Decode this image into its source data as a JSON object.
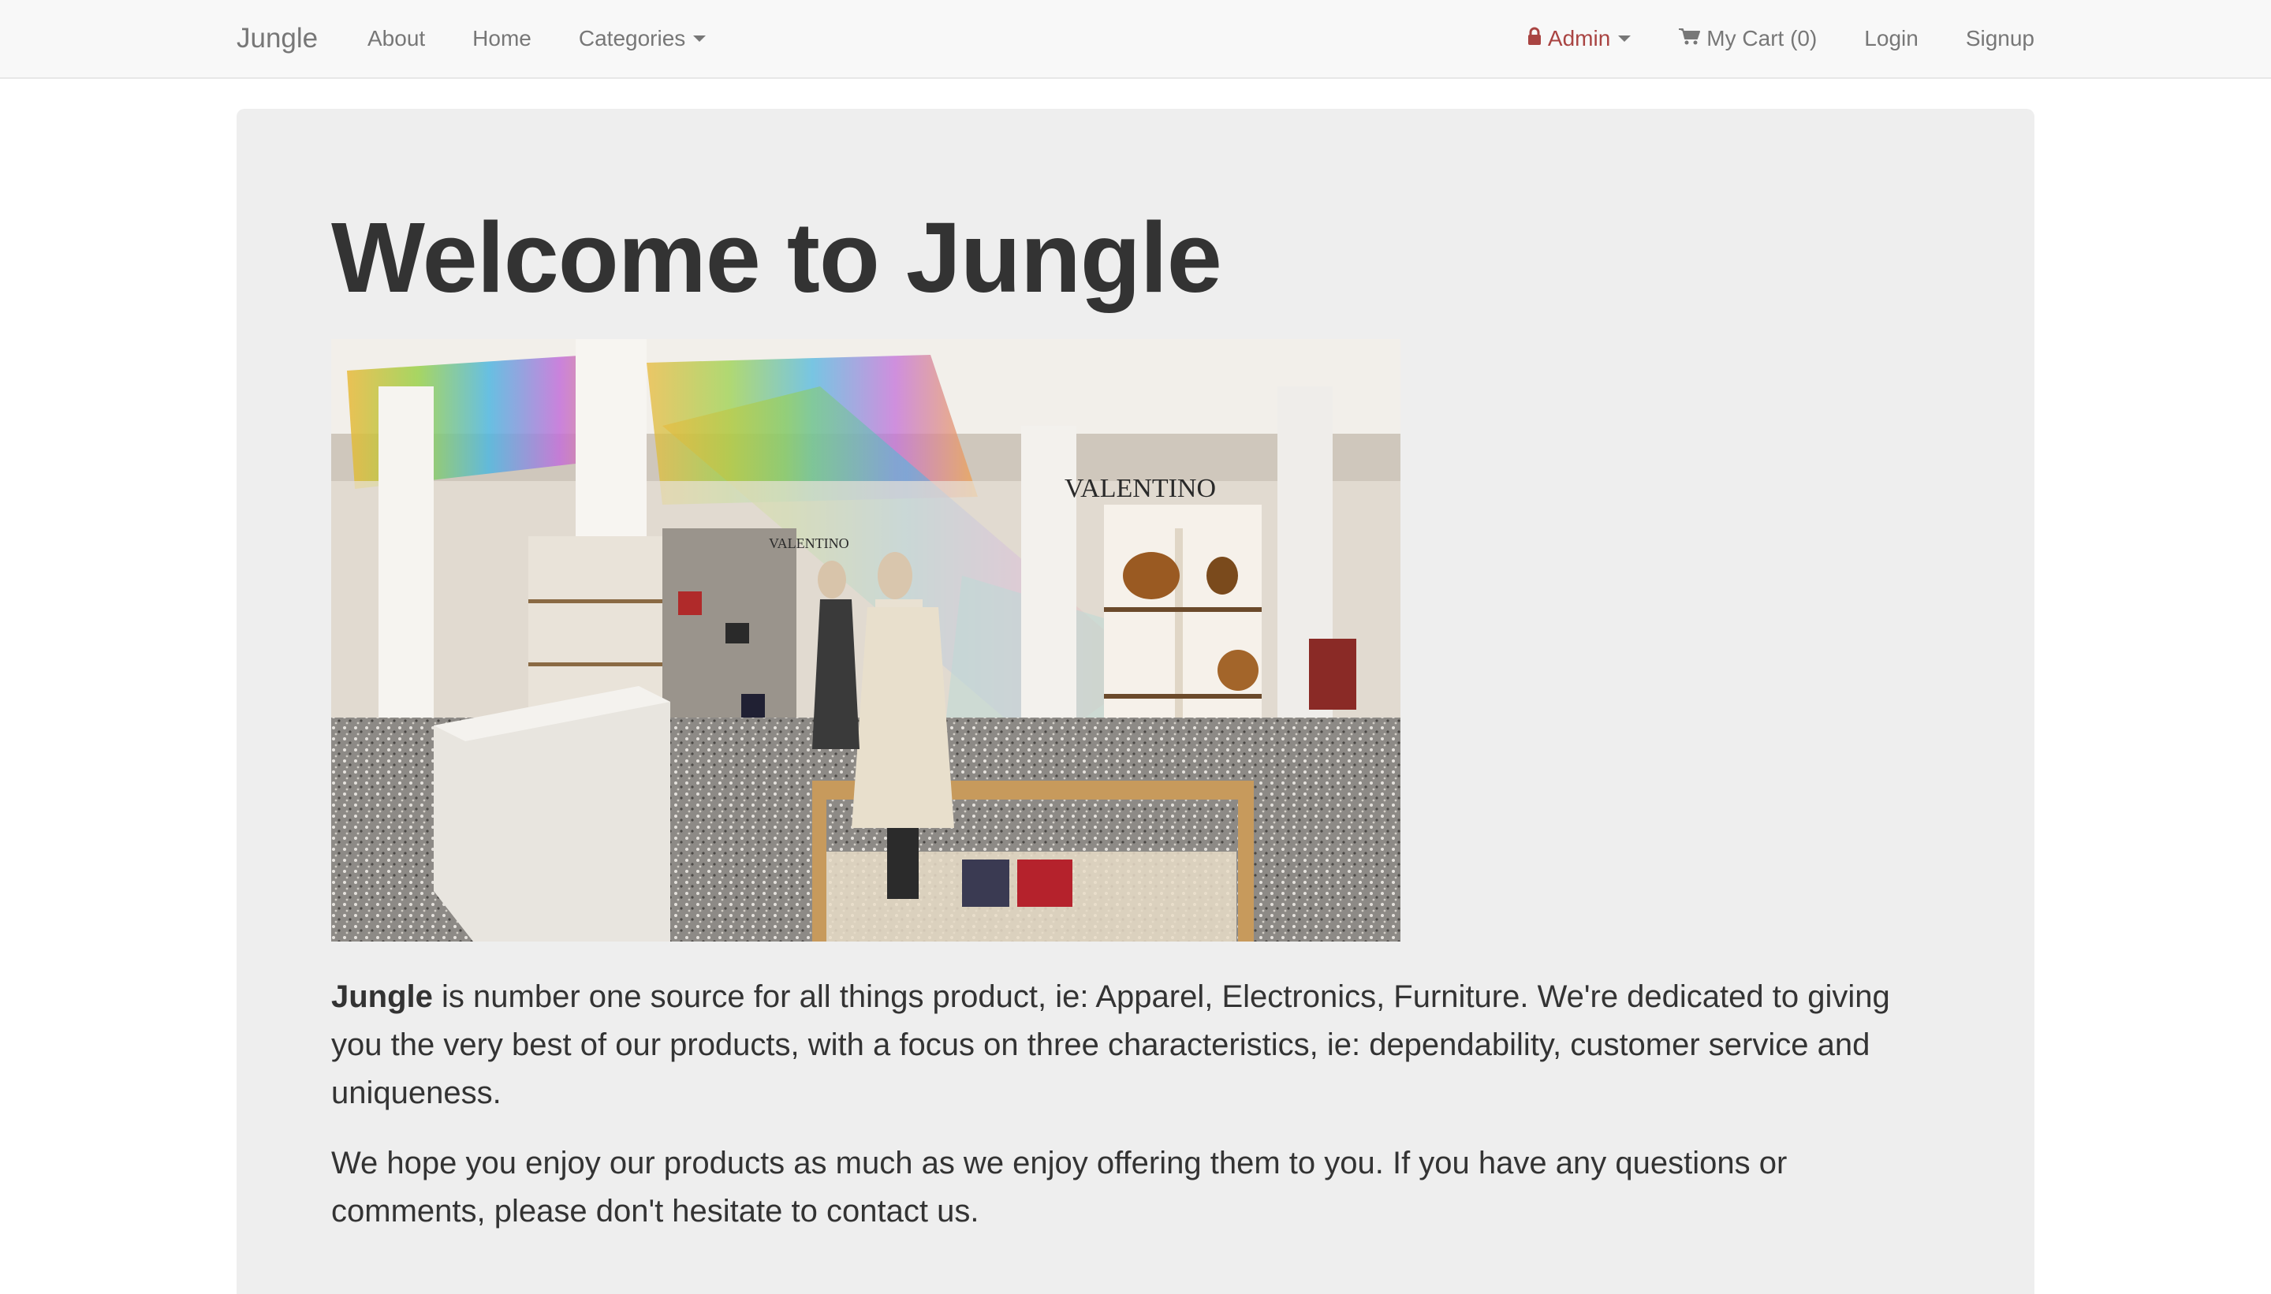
{
  "navbar": {
    "brand": "Jungle",
    "left_links": [
      "About",
      "Home",
      "Categories"
    ],
    "admin_label": "Admin",
    "cart_label": "My Cart (0)",
    "login_label": "Login",
    "signup_label": "Signup"
  },
  "jumbotron": {
    "title": "Welcome to Jungle",
    "paragraph1_bold": "Jungle",
    "paragraph1_rest": " is number one source for all things product, ie: Apparel, Electronics, Furniture. We're dedicated to giving you the very best of our products, with a focus on three characteristics, ie: dependability, customer service and uniqueness.",
    "paragraph2": "We hope you enjoy our products as much as we enjoy offering them to you. If you have any questions or comments, please don't hesitate to contact us.",
    "image_signage": [
      "VALENTINO",
      "VALENTINO"
    ]
  },
  "icons": {
    "admin": "lock-icon",
    "cart": "shopping-cart-icon",
    "dropdown": "caret-down-icon"
  },
  "colors": {
    "navbar_bg": "#f8f8f8",
    "nav_text": "#777777",
    "admin_text": "#a94442",
    "jumbotron_bg": "#eeeeee",
    "body_text": "#333333"
  }
}
